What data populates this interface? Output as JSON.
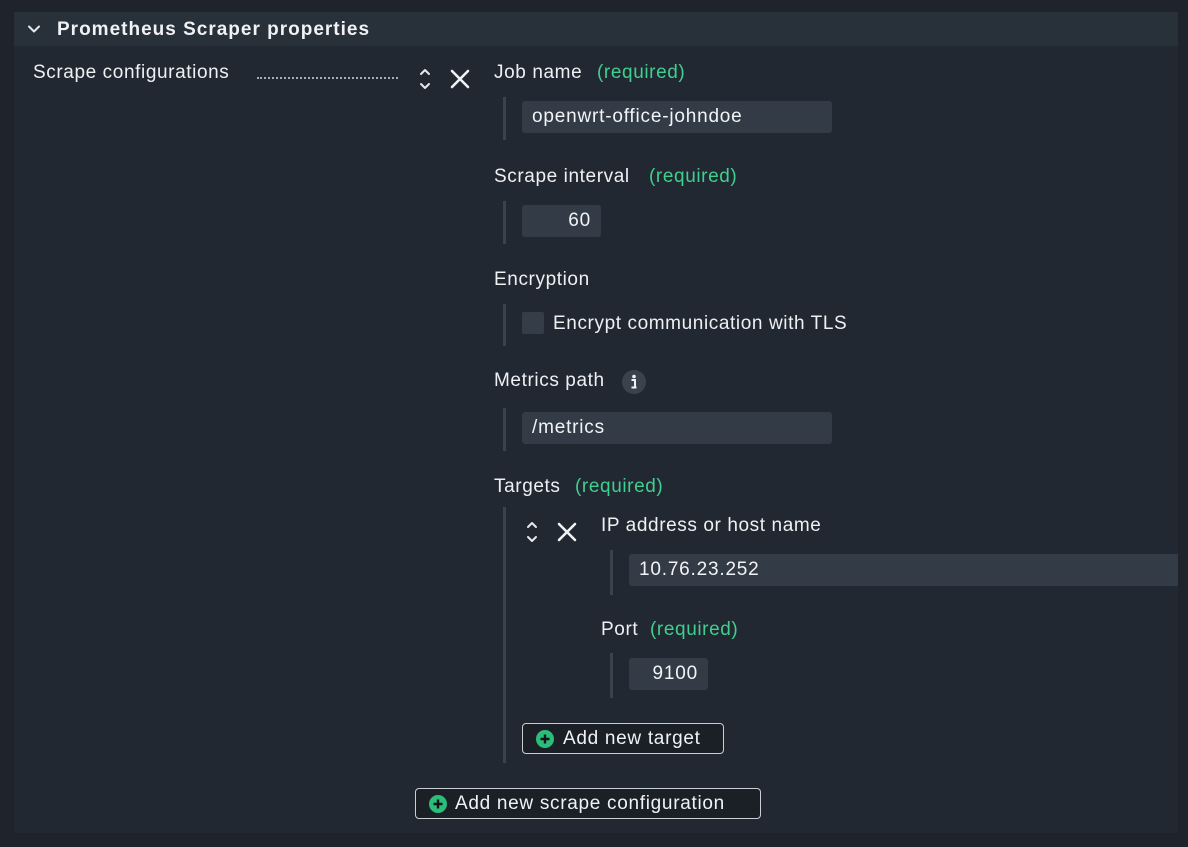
{
  "panel": {
    "title": "Prometheus Scraper properties"
  },
  "scrape": {
    "section_label": "Scrape configurations",
    "job_name": {
      "label": "Job name",
      "required": "(required)",
      "value": "openwrt-office-johndoe"
    },
    "scrape_interval": {
      "label": "Scrape interval",
      "required": "(required)",
      "value": "60"
    },
    "encryption": {
      "label": "Encryption",
      "checkbox_label": "Encrypt communication with TLS",
      "checked": false
    },
    "metrics_path": {
      "label": "Metrics path",
      "value": "/metrics"
    },
    "targets": {
      "label": "Targets",
      "required": "(required)",
      "items": [
        {
          "host_label": "IP address or host name",
          "host_value": "10.76.23.252",
          "port_label": "Port",
          "port_required": "(required)",
          "port_value": "9100"
        }
      ],
      "add_button": "Add new target"
    },
    "add_button": "Add new scrape configuration"
  },
  "colors": {
    "background": "#1e232c",
    "panel": "#222831",
    "input": "#333b46",
    "required": "#3fcf8e",
    "add_icon": "#2dbd7a"
  },
  "icons": [
    "chevron-down-icon",
    "move-icon",
    "close-icon",
    "info-icon",
    "plus-circle-icon"
  ]
}
